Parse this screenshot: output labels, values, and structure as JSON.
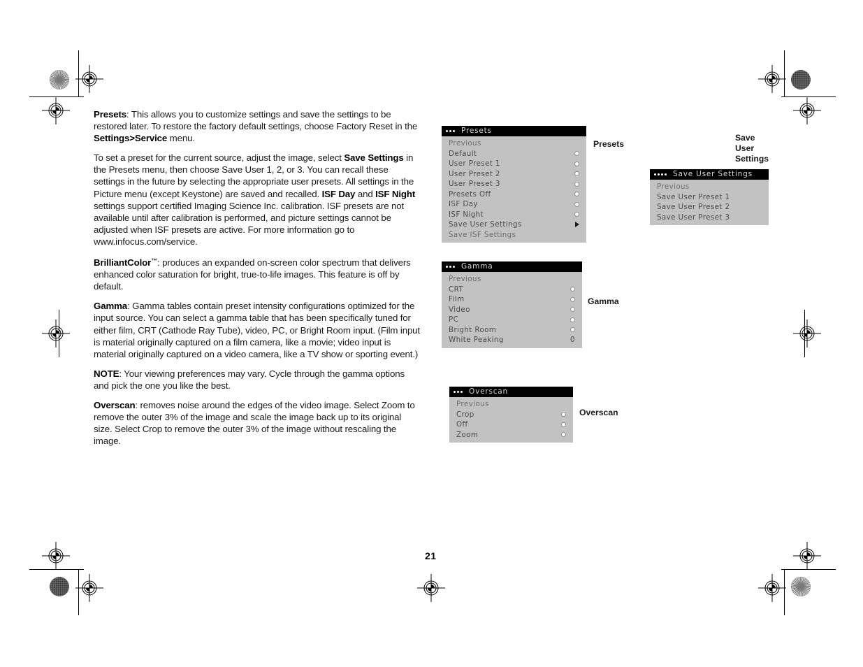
{
  "page": {
    "number": "21",
    "background": "#ffffff"
  },
  "body_text": {
    "paragraphs": [
      {
        "id": "presets",
        "runs": [
          {
            "text": "Presets",
            "bold": true
          },
          {
            "text": ": This allows you to customize settings and save the settings to be restored later. To restore the factory default settings, choose Factory Reset in the ",
            "bold": false
          },
          {
            "text": "Settings>Service",
            "bold": true
          },
          {
            "text": " menu.",
            "bold": false
          }
        ]
      },
      {
        "id": "save-settings",
        "runs": [
          {
            "text": "To set a preset for the current source, adjust the image, select ",
            "bold": false
          },
          {
            "text": "Save Settings",
            "bold": true
          },
          {
            "text": " in the Presets menu, then choose Save User 1, 2, or 3. You can recall these settings in the future by selecting the appropriate user presets. All settings in the Picture menu (except Keystone) are saved and recalled. ",
            "bold": false
          },
          {
            "text": "ISF Day",
            "bold": true
          },
          {
            "text": " and ",
            "bold": false
          },
          {
            "text": "ISF Night",
            "bold": true
          },
          {
            "text": " settings support certified Imaging Science Inc. calibration. ISF presets are not available until after calibration is performed, and picture settings cannot be adjusted when ISF presets are active. For more information go to www.infocus.com/service.",
            "bold": false
          }
        ]
      },
      {
        "id": "brilliantcolor",
        "runs": [
          {
            "text": "BrilliantColor",
            "bold": true
          },
          {
            "text": "™",
            "bold": true,
            "sup": true
          },
          {
            "text": ": produces an expanded on-screen color spectrum that delivers enhanced color saturation for bright, true-to-life images. This feature is off by default.",
            "bold": false
          }
        ]
      },
      {
        "id": "gamma",
        "runs": [
          {
            "text": "Gamma",
            "bold": true
          },
          {
            "text": ": Gamma tables contain preset intensity configurations optimized for the input source. You can select a gamma table that has been specifically tuned for either film, CRT (Cathode Ray Tube), video, PC, or Bright Room input. (Film input is material originally captured on a film camera, like a movie; video input is material originally captured on a video camera, like a TV show or sporting event.)",
            "bold": false
          }
        ]
      },
      {
        "id": "note",
        "runs": [
          {
            "text": "NOTE",
            "bold": true
          },
          {
            "text": ": Your viewing preferences may vary. Cycle through the gamma options and pick the one you like the best.",
            "bold": false
          }
        ]
      },
      {
        "id": "overscan",
        "runs": [
          {
            "text": "Overscan",
            "bold": true
          },
          {
            "text": ": removes noise around the edges of the video image. Select Zoom to remove the outer 3% of the image and scale the image back up to its original size. Select Crop to remove the outer 3% of the image without rescaling the image.",
            "bold": false
          }
        ]
      }
    ]
  },
  "menus": {
    "presets": {
      "title": "Presets",
      "dots": 3,
      "caption": "Presets",
      "rows": [
        {
          "label": "Previous",
          "control": "none",
          "dim": true
        },
        {
          "label": "Default",
          "control": "radio"
        },
        {
          "label": "User Preset 1",
          "control": "radio"
        },
        {
          "label": "User Preset 2",
          "control": "radio"
        },
        {
          "label": "User Preset 3",
          "control": "radio"
        },
        {
          "label": "Presets Off",
          "control": "radio"
        },
        {
          "label": "ISF Day",
          "control": "radio"
        },
        {
          "label": "ISF Night",
          "control": "radio"
        },
        {
          "label": "Save User Settings",
          "control": "arrow"
        },
        {
          "label": "Save ISF Settings",
          "control": "none",
          "dim": true
        }
      ]
    },
    "save_user_settings": {
      "title": "Save User Settings",
      "dots": 4,
      "caption": "Save\nUser\nSettings",
      "rows": [
        {
          "label": "Previous",
          "control": "none",
          "dim": true
        },
        {
          "label": "Save User Preset 1",
          "control": "none"
        },
        {
          "label": "Save User Preset 2",
          "control": "none"
        },
        {
          "label": "Save User Preset 3",
          "control": "none"
        }
      ]
    },
    "gamma": {
      "title": "Gamma",
      "dots": 3,
      "caption": "Gamma",
      "rows": [
        {
          "label": "Previous",
          "control": "none",
          "dim": true
        },
        {
          "label": "CRT",
          "control": "radio"
        },
        {
          "label": "Film",
          "control": "radio"
        },
        {
          "label": "Video",
          "control": "radio"
        },
        {
          "label": "PC",
          "control": "radio"
        },
        {
          "label": "Bright Room",
          "control": "radio"
        },
        {
          "label": "White Peaking",
          "control": "value",
          "value": "0"
        }
      ]
    },
    "overscan": {
      "title": "Overscan",
      "dots": 3,
      "caption": "Overscan",
      "rows": [
        {
          "label": "Previous",
          "control": "none",
          "dim": true
        },
        {
          "label": "Crop",
          "control": "radio"
        },
        {
          "label": "Off",
          "control": "radio"
        },
        {
          "label": "Zoom",
          "control": "radio"
        }
      ]
    }
  },
  "colors": {
    "menu_background": "#c2c2c2",
    "menu_titlebar": "#000000",
    "menu_title_text": "#d8d8d8",
    "menu_row_text": "#4a4a4a",
    "page_text": "#1a1a1a"
  }
}
